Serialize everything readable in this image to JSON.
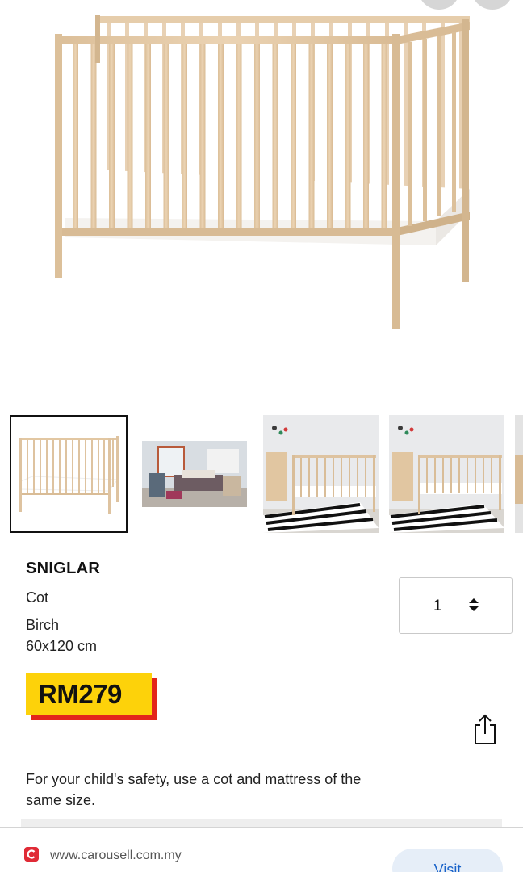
{
  "product": {
    "name": "SNIGLAR",
    "type": "Cot",
    "color": "Birch",
    "size": "60x120 cm",
    "price": "RM279",
    "quantity": "1",
    "safety_note": "For your child's safety, use a cot and mattress of the same size."
  },
  "gallery": {
    "thumbnails": [
      {
        "name": "thumb-cot-white-background",
        "selected": true
      },
      {
        "name": "thumb-bedroom-scene"
      },
      {
        "name": "thumb-nursery-rug-1"
      },
      {
        "name": "thumb-nursery-rug-2"
      },
      {
        "name": "thumb-partial"
      }
    ]
  },
  "footer": {
    "url": "www.carousell.com.my",
    "visit_label": "Visit"
  },
  "colors": {
    "price_yellow": "#fdd20a",
    "price_red": "#e3251b",
    "wood": "#e4c9a6",
    "mattress": "#ffffff",
    "carousell_red": "#e02b36",
    "visit_blue": "#1a63c9"
  },
  "icons": {
    "share": "share-icon",
    "quantity_stepper": "up-down-arrows-icon",
    "site_logo": "carousell-logo-icon"
  }
}
